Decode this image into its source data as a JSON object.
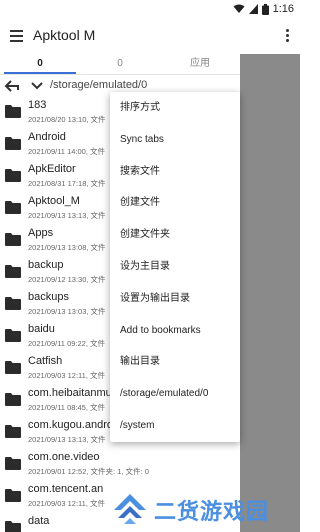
{
  "status_bar": {
    "time": "1:16"
  },
  "app_bar": {
    "title": "Apktool M"
  },
  "tabs": [
    {
      "label": "0"
    },
    {
      "label": "0"
    },
    {
      "label": "应用"
    }
  ],
  "path_bar": {
    "path": "/storage/emulated/0"
  },
  "files": [
    {
      "name": "183",
      "meta": "2021/08/20 13:10, 文件"
    },
    {
      "name": "Android",
      "meta": "2021/09/11 14:00, 文件"
    },
    {
      "name": "ApkEditor",
      "meta": "2021/08/31 17:18, 文件"
    },
    {
      "name": "Apktool_M",
      "meta": "2021/09/13 13:13, 文件"
    },
    {
      "name": "Apps",
      "meta": "2021/09/13 13:08, 文件"
    },
    {
      "name": "backup",
      "meta": "2021/09/12 13:30, 文件"
    },
    {
      "name": "backups",
      "meta": "2021/09/13 13:03, 文件"
    },
    {
      "name": "baidu",
      "meta": "2021/09/11 09:22, 文件"
    },
    {
      "name": "Catfish",
      "meta": "2021/09/03 12:11, 文件"
    },
    {
      "name": "com.heibaitanmu",
      "meta": "2021/09/11 08:45, 文件"
    },
    {
      "name": "com.kugou.andro",
      "meta": "2021/09/13 13:13, 文件"
    },
    {
      "name": "com.one.video",
      "meta": "2021/09/01 12:52, 文件夹: 1, 文件: 0"
    },
    {
      "name": "com.tencent.an",
      "meta": "2021/09/03 12:11, 文件"
    },
    {
      "name": "data",
      "meta": ""
    }
  ],
  "dropdown": {
    "items": [
      {
        "label": "排序方式"
      },
      {
        "label": "Sync tabs"
      },
      {
        "label": "搜索文件"
      },
      {
        "label": "创建文件"
      },
      {
        "label": "创建文件夹"
      },
      {
        "label": "设为主目录"
      },
      {
        "label": "设置为输出目录"
      },
      {
        "label": "Add to bookmarks"
      },
      {
        "label": "输出目录"
      },
      {
        "label": "/storage/emulated/0"
      },
      {
        "label": "/system"
      }
    ]
  },
  "watermark": {
    "text": "二货游戏园"
  }
}
